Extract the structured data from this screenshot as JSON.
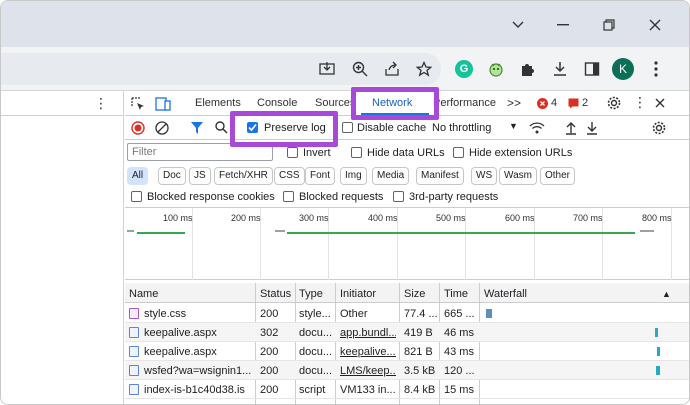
{
  "devtools": {
    "tabs": [
      "Elements",
      "Console",
      "Sources",
      "Network",
      "Performance"
    ],
    "active_tab": "Network",
    "more_tabs": ">>",
    "errors_count": "4",
    "issues_count": "2",
    "preserve_log": "Preserve log",
    "disable_cache": "Disable cache",
    "throttling": "No throttling",
    "filter_placeholder": "Filter",
    "invert": "Invert",
    "hide_data_urls": "Hide data URLs",
    "hide_extension_urls": "Hide extension URLs",
    "type_filters": [
      "All",
      "Doc",
      "JS",
      "Fetch/XHR",
      "CSS",
      "Font",
      "Img",
      "Media",
      "Manifest",
      "WS",
      "Wasm",
      "Other"
    ],
    "blocked_cookies": "Blocked response cookies",
    "blocked_requests": "Blocked requests",
    "third_party": "3rd-party requests",
    "timeline_ticks": [
      "100 ms",
      "200 ms",
      "300 ms",
      "400 ms",
      "500 ms",
      "600 ms",
      "700 ms",
      "800 ms"
    ],
    "columns": [
      "Name",
      "Status",
      "Type",
      "Initiator",
      "Size",
      "Time",
      "Waterfall"
    ],
    "rows": [
      {
        "name": "style.css",
        "status": "200",
        "type": "style...",
        "initiator": "Other",
        "size": "77.4 ...",
        "time": "665 ..."
      },
      {
        "name": "keepalive.aspx",
        "status": "302",
        "type": "docu...",
        "initiator": "app.bundl...",
        "size": "419 B",
        "time": "46 ms"
      },
      {
        "name": "keepalive.aspx",
        "status": "200",
        "type": "docu...",
        "initiator": "keepalive....",
        "size": "821 B",
        "time": "43 ms"
      },
      {
        "name": "wsfed?wa=wsignin1....",
        "status": "200",
        "type": "docu...",
        "initiator": "LMS/keep...",
        "size": "3.5 kB",
        "time": "120 ..."
      },
      {
        "name": "index-is-b1c40d38.is",
        "status": "200",
        "type": "script",
        "initiator": "VM133 in...",
        "size": "8.4 kB",
        "time": "15 ms"
      }
    ]
  },
  "browser": {
    "profile_initial": "K",
    "grammarly_initial": "G"
  },
  "colors": {
    "highlight": "#a64ad7",
    "accent": "#1a73e8",
    "error": "#d93025"
  },
  "icons": [
    "chevron-down-icon",
    "minimize-icon",
    "restore-icon",
    "close-icon",
    "install-icon",
    "zoom-icon",
    "share-icon",
    "bookmark-star-icon",
    "grammarly-icon",
    "extension-icon",
    "puzzle-icon",
    "download-icon",
    "sidepanel-icon",
    "menu-dots-icon"
  ]
}
